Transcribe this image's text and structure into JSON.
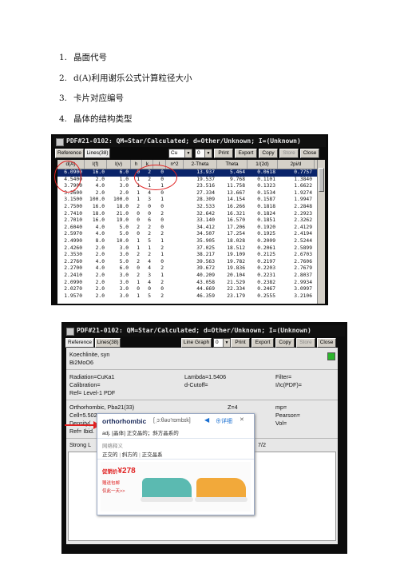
{
  "list_items": [
    {
      "num": "1.",
      "text": "晶面代号"
    },
    {
      "num": "2.",
      "text": "d(A)利用谢乐公式计算粒径大小"
    },
    {
      "num": "3.",
      "text": "卡片对应编号"
    },
    {
      "num": "4.",
      "text": "晶体的结构类型"
    }
  ],
  "window1": {
    "title": "PDF#21-0102: QM=Star/Calculated; d=Other/Unknown; I=(Unknown)",
    "tabs": [
      "Reference",
      "Lines(38)"
    ],
    "radiation_select": "Cu",
    "wavelength_select": "0",
    "buttons": [
      "Print",
      "Export",
      "Copy",
      "Store",
      "Close"
    ],
    "columns": [
      "d(A)",
      "I(f)",
      "I(v)",
      "h",
      "k",
      "l",
      "n^2",
      "2-Theta",
      "Theta",
      "1/(2d)",
      "2pi/d"
    ],
    "rows": [
      [
        "6.0900",
        "16.0",
        "6.0",
        "0",
        "2",
        "0",
        "",
        "13.937",
        "5.464",
        "0.0618",
        "0.7757"
      ],
      [
        "4.5400",
        "2.0",
        "1.0",
        "1",
        "2",
        "0",
        "",
        "19.537",
        "9.768",
        "0.1101",
        "1.3840"
      ],
      [
        "3.7900",
        "4.0",
        "3.0",
        "1",
        "1",
        "1",
        "",
        "23.516",
        "11.758",
        "0.1323",
        "1.6622"
      ],
      [
        "3.2600",
        "2.0",
        "2.0",
        "1",
        "4",
        "0",
        "",
        "27.334",
        "13.667",
        "0.1534",
        "1.9274"
      ],
      [
        "3.1500",
        "100.0",
        "100.0",
        "1",
        "3",
        "1",
        "",
        "28.309",
        "14.154",
        "0.1587",
        "1.9947"
      ],
      [
        "2.7500",
        "16.0",
        "18.0",
        "2",
        "0",
        "0",
        "",
        "32.533",
        "16.266",
        "0.1818",
        "2.2848"
      ],
      [
        "2.7410",
        "18.0",
        "21.0",
        "0",
        "0",
        "2",
        "",
        "32.642",
        "16.321",
        "0.1824",
        "2.2923"
      ],
      [
        "2.7010",
        "16.0",
        "19.0",
        "0",
        "6",
        "0",
        "",
        "33.140",
        "16.570",
        "0.1851",
        "2.3262"
      ],
      [
        "2.6040",
        "4.0",
        "5.0",
        "2",
        "2",
        "0",
        "",
        "34.412",
        "17.206",
        "0.1920",
        "2.4129"
      ],
      [
        "2.5970",
        "4.0",
        "5.0",
        "0",
        "2",
        "2",
        "",
        "34.507",
        "17.254",
        "0.1925",
        "2.4194"
      ],
      [
        "2.4990",
        "8.0",
        "10.0",
        "1",
        "5",
        "1",
        "",
        "35.905",
        "18.028",
        "0.2009",
        "2.5244"
      ],
      [
        "2.4260",
        "2.0",
        "3.0",
        "1",
        "1",
        "2",
        "",
        "37.025",
        "18.512",
        "0.2061",
        "2.5899"
      ],
      [
        "2.3530",
        "2.0",
        "3.0",
        "2",
        "2",
        "1",
        "",
        "38.217",
        "19.109",
        "0.2125",
        "2.6703"
      ],
      [
        "2.2760",
        "4.0",
        "5.0",
        "2",
        "4",
        "0",
        "",
        "39.563",
        "19.782",
        "0.2197",
        "2.7606"
      ],
      [
        "2.2700",
        "4.0",
        "6.0",
        "0",
        "4",
        "2",
        "",
        "39.672",
        "19.836",
        "0.2203",
        "2.7679"
      ],
      [
        "2.2410",
        "2.0",
        "3.0",
        "2",
        "3",
        "1",
        "",
        "40.209",
        "20.104",
        "0.2231",
        "2.8037"
      ],
      [
        "2.0990",
        "2.0",
        "3.0",
        "1",
        "4",
        "2",
        "",
        "43.058",
        "21.529",
        "0.2382",
        "2.9934"
      ],
      [
        "2.0270",
        "2.0",
        "3.0",
        "0",
        "0",
        "0",
        "",
        "44.669",
        "22.334",
        "0.2467",
        "3.0997"
      ],
      [
        "1.9570",
        "2.0",
        "3.0",
        "1",
        "5",
        "2",
        "",
        "46.359",
        "23.179",
        "0.2555",
        "3.2106"
      ]
    ]
  },
  "window2": {
    "title": "PDF#21-0102: QM=Star/Calculated; d=Other/Unknown; I=(Unknown)",
    "tabs": [
      "Reference",
      "Lines(38)"
    ],
    "buttons": [
      "Line Graph",
      "Print",
      "Export",
      "Copy",
      "Store",
      "Close"
    ],
    "wavelength_select": "0",
    "mineral_name": "Koechlinite, syn",
    "formula": "Bi2MoO6",
    "radiation": "Radiation=CuKa1",
    "lambda": "Lambda=1.5406",
    "filter": "Filter=",
    "calibration": "Calibration=",
    "dcutoff": "d-Cutoff=",
    "icpdf": "I/Ic(PDF)=",
    "ref": "Ref= Level-1 PDF",
    "crystal_system": "Orthorhombic, Pba21(33)",
    "z": "Z=4",
    "mp": "mp=",
    "cell": "Cell=5.502x16.21x5.483<90x90x90>",
    "pearson": "Pearson=",
    "density": "Density(",
    "vol": "Vol=",
    "ref2": "Ref= Ibid.",
    "strong_lines": "Strong L",
    "strong_suffix": "7/2",
    "popup": {
      "word": "orthorhombic",
      "phonetic": "[ˌɔ:θəʊ'rɒmbɪk]",
      "detail_link": "详细",
      "definition": "adj. [晶体] 正交晶的；斜方晶系的",
      "synonyms_title": "网络释义",
      "synonyms": [
        "正交的",
        "斜方的",
        "正交晶系"
      ],
      "ad_price_label": "促销价",
      "ad_price": "¥278",
      "ad_shipping": "赠送包邮",
      "ad_note": "仅此一天>>"
    }
  },
  "colors": {
    "ellipse": "#e02020",
    "arrow": "#e02020",
    "highlight_row": "#0a246a"
  }
}
